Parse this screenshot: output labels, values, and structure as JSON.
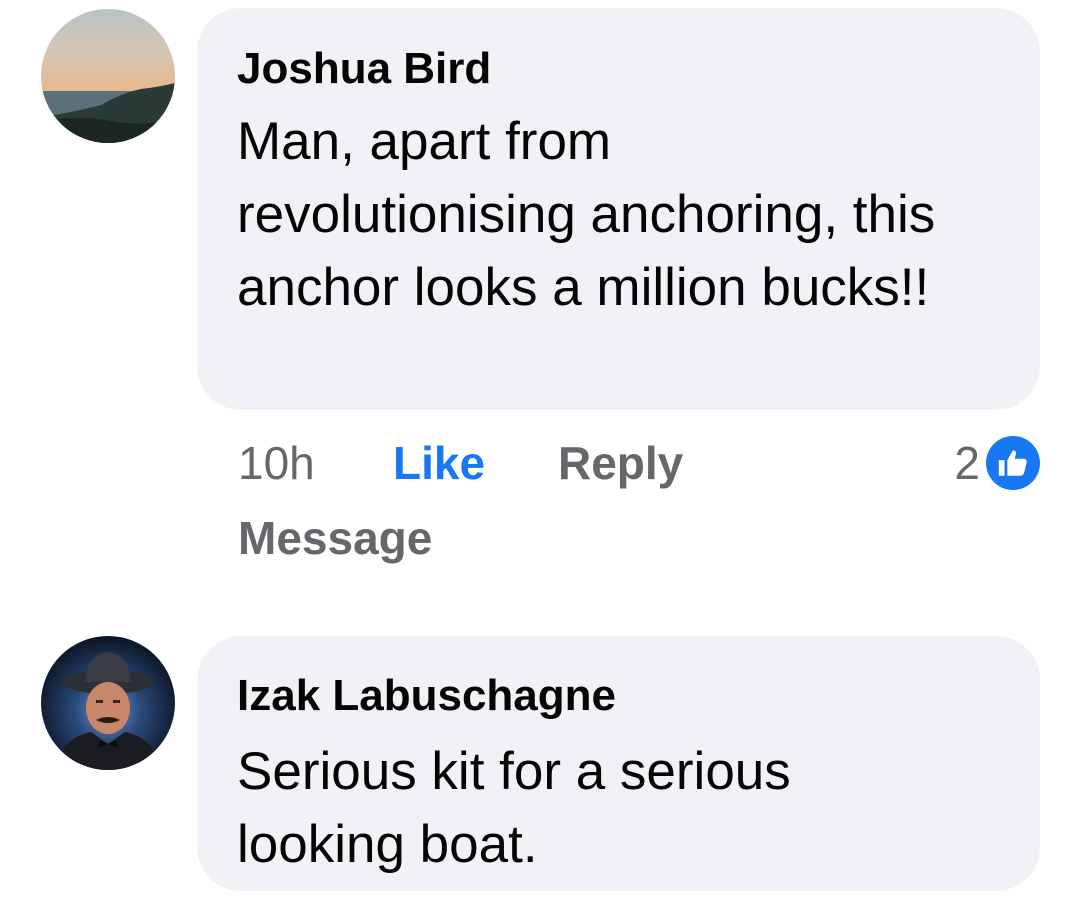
{
  "comments": [
    {
      "author": "Joshua Bird",
      "text": "Man, apart from revolutionising anchoring, this anchor looks a million bucks!!",
      "avatar": "sunset-coast-photo",
      "timestamp": "10h",
      "actions": {
        "like": "Like",
        "reply": "Reply",
        "message": "Message"
      },
      "reaction_count": "2",
      "reaction_icon": "thumbs-up-icon"
    },
    {
      "author": "Izak Labuschagne",
      "text": "Serious kit for a serious looking boat.",
      "avatar": "man-in-hat-portrait"
    }
  ],
  "colors": {
    "bubble": "#f0f2f5",
    "text": "#050505",
    "secondary": "#65676b",
    "like_blue": "#1877f2"
  }
}
